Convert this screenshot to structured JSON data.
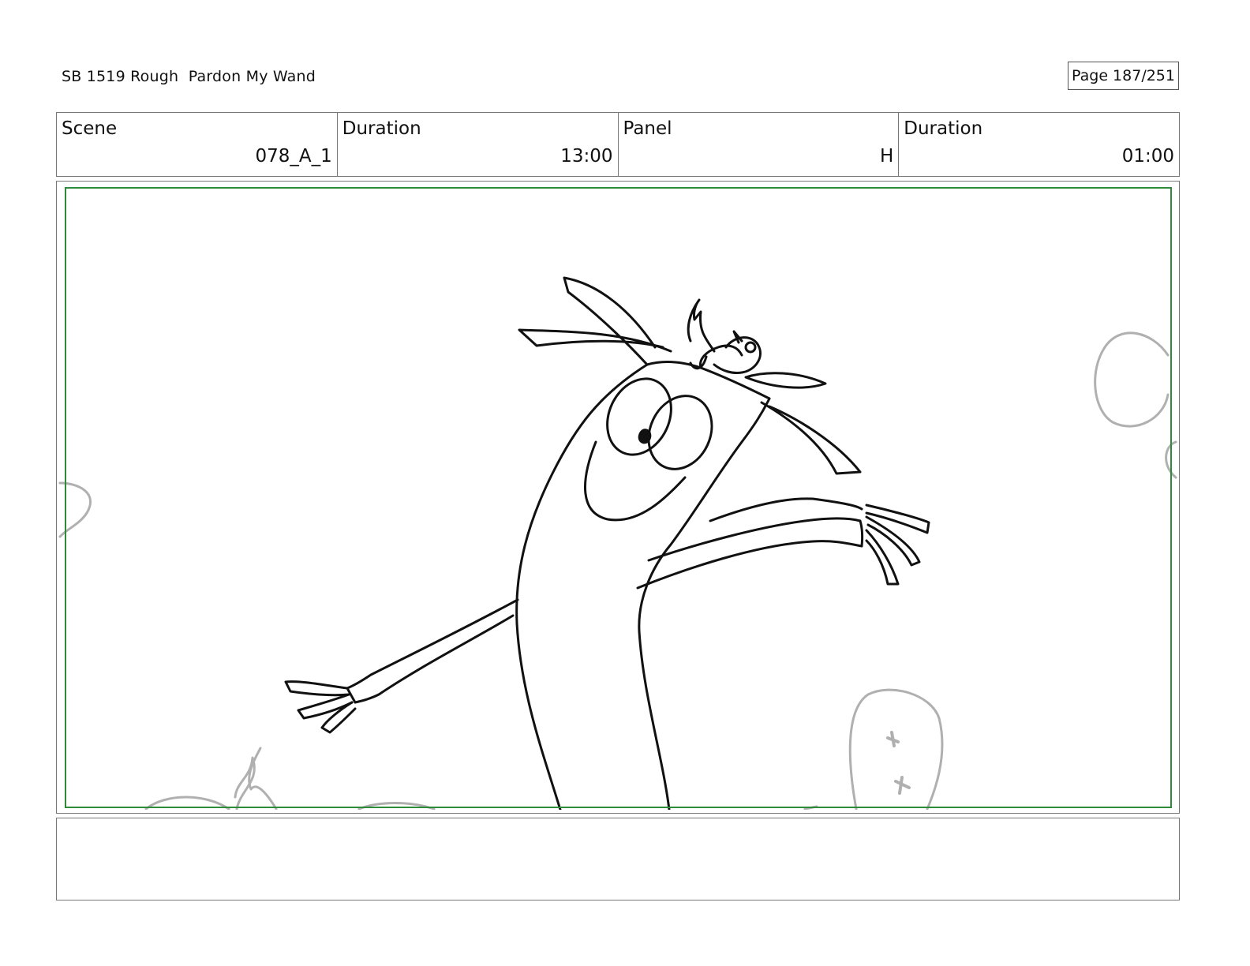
{
  "header": {
    "title": "SB 1519 Rough  Pardon My Wand",
    "page": "Page 187/251"
  },
  "info": {
    "scene_label": "Scene",
    "scene_value": "078_A_1",
    "scene_duration_label": "Duration",
    "scene_duration_value": "13:00",
    "panel_label": "Panel",
    "panel_value": "H",
    "panel_duration_label": "Duration",
    "panel_duration_value": "01:00"
  },
  "panel": {
    "safe_area_color": "#2e8b3a",
    "line_color": "#111111",
    "background_sketch_color": "#b0b0b0"
  },
  "notes": {
    "text": ""
  }
}
